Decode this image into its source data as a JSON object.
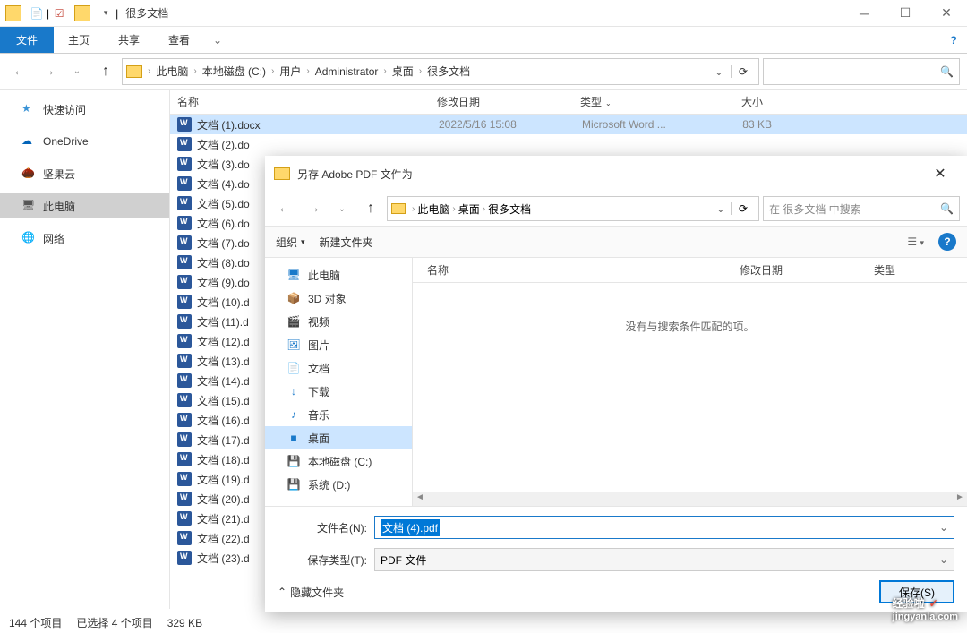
{
  "titlebar": {
    "title": "很多文档",
    "sep": "|"
  },
  "ribbon": {
    "file": "文件",
    "tabs": [
      "主页",
      "共享",
      "查看"
    ]
  },
  "nav": {
    "breadcrumbs": [
      "此电脑",
      "本地磁盘 (C:)",
      "用户",
      "Administrator",
      "桌面",
      "很多文档"
    ]
  },
  "sidebar": {
    "items": [
      {
        "label": "快速访问",
        "icon": "star"
      },
      {
        "label": "OneDrive",
        "icon": "cloud"
      },
      {
        "label": "坚果云",
        "icon": "nut"
      },
      {
        "label": "此电脑",
        "icon": "pc",
        "selected": true
      },
      {
        "label": "网络",
        "icon": "net"
      }
    ]
  },
  "columns": {
    "name": "名称",
    "date": "修改日期",
    "type": "类型",
    "size": "大小"
  },
  "files": [
    {
      "name": "文档 (1).docx",
      "date": "2022/5/16 15:08",
      "type": "Microsoft Word ...",
      "size": "83 KB",
      "selected": true
    },
    {
      "name": "文档 (2).do"
    },
    {
      "name": "文档 (3).do"
    },
    {
      "name": "文档 (4).do"
    },
    {
      "name": "文档 (5).do"
    },
    {
      "name": "文档 (6).do"
    },
    {
      "name": "文档 (7).do"
    },
    {
      "name": "文档 (8).do"
    },
    {
      "name": "文档 (9).do"
    },
    {
      "name": "文档 (10).d"
    },
    {
      "name": "文档 (11).d"
    },
    {
      "name": "文档 (12).d"
    },
    {
      "name": "文档 (13).d"
    },
    {
      "name": "文档 (14).d"
    },
    {
      "name": "文档 (15).d"
    },
    {
      "name": "文档 (16).d"
    },
    {
      "name": "文档 (17).d"
    },
    {
      "name": "文档 (18).d"
    },
    {
      "name": "文档 (19).d"
    },
    {
      "name": "文档 (20).d"
    },
    {
      "name": "文档 (21).d"
    },
    {
      "name": "文档 (22).d"
    },
    {
      "name": "文档 (23).d"
    }
  ],
  "status": {
    "count": "144 个项目",
    "selection": "已选择 4 个项目",
    "size": "329 KB"
  },
  "dialog": {
    "title": "另存 Adobe PDF 文件为",
    "breadcrumbs": [
      "此电脑",
      "桌面",
      "很多文档"
    ],
    "search_placeholder": "在 很多文档 中搜索",
    "toolbar": {
      "organize": "组织",
      "newfolder": "新建文件夹"
    },
    "tree": [
      {
        "label": "此电脑",
        "icon": "monitor"
      },
      {
        "label": "3D 对象",
        "icon": "3d"
      },
      {
        "label": "视频",
        "icon": "video"
      },
      {
        "label": "图片",
        "icon": "pic"
      },
      {
        "label": "文档",
        "icon": "doc"
      },
      {
        "label": "下载",
        "icon": "down"
      },
      {
        "label": "音乐",
        "icon": "music"
      },
      {
        "label": "桌面",
        "icon": "desk",
        "selected": true
      },
      {
        "label": "本地磁盘 (C:)",
        "icon": "disk"
      },
      {
        "label": "系统 (D:)",
        "icon": "disk"
      }
    ],
    "columns": {
      "name": "名称",
      "date": "修改日期",
      "type": "类型"
    },
    "empty": "没有与搜索条件匹配的项。",
    "filename_label": "文件名(N):",
    "filename_value": "文档 (4).pdf",
    "filetype_label": "保存类型(T):",
    "filetype_value": "PDF 文件",
    "hide_folders": "隐藏文件夹",
    "save_button": "保存(S)"
  },
  "watermark": {
    "text": "经验啦",
    "check": "✓",
    "url": "jingyanla.com"
  }
}
